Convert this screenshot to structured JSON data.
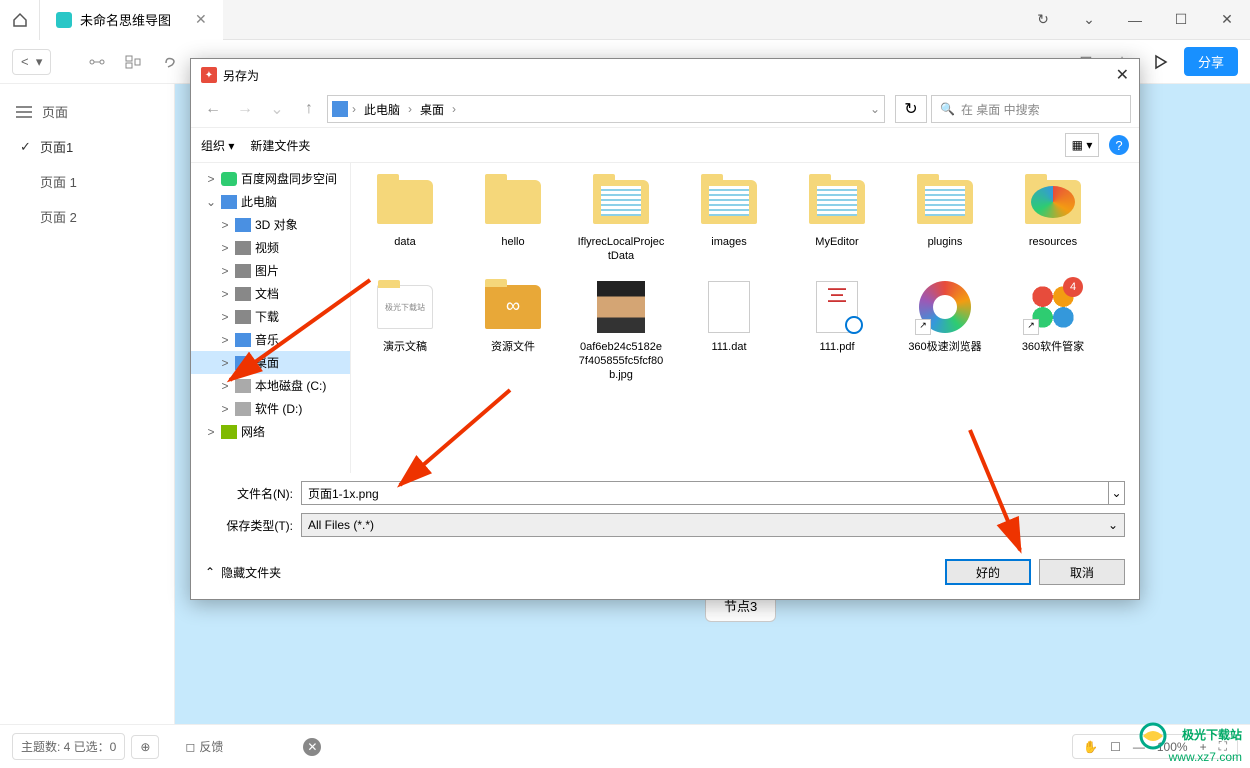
{
  "tab": {
    "title": "未命名思维导图"
  },
  "toolbar": {
    "share": "分享"
  },
  "sidebar": {
    "header": "页面",
    "items": [
      {
        "label": "页面1",
        "active": true
      },
      {
        "label": "页面 1",
        "active": false
      },
      {
        "label": "页面 2",
        "active": false
      }
    ]
  },
  "canvas": {
    "node3": "节点3"
  },
  "status": {
    "topics": "主题数: 4 已选：0",
    "feedback": "反馈",
    "zoom": "100%"
  },
  "dialog": {
    "title": "另存为",
    "path": {
      "root": "此电脑",
      "current": "桌面"
    },
    "search_placeholder": "在 桌面 中搜索",
    "toolbar": {
      "organize": "组织",
      "new_folder": "新建文件夹"
    },
    "tree": [
      {
        "label": "百度网盘同步空间",
        "indent": 1,
        "exp": ">",
        "icon": "ico-cloud"
      },
      {
        "label": "此电脑",
        "indent": 1,
        "exp": "⌄",
        "icon": "ico-monitor"
      },
      {
        "label": "3D 对象",
        "indent": 2,
        "exp": ">",
        "icon": "ico-blue"
      },
      {
        "label": "视频",
        "indent": 2,
        "exp": ">",
        "icon": "ico-generic"
      },
      {
        "label": "图片",
        "indent": 2,
        "exp": ">",
        "icon": "ico-generic"
      },
      {
        "label": "文档",
        "indent": 2,
        "exp": ">",
        "icon": "ico-generic"
      },
      {
        "label": "下载",
        "indent": 2,
        "exp": ">",
        "icon": "ico-generic"
      },
      {
        "label": "音乐",
        "indent": 2,
        "exp": ">",
        "icon": "ico-blue"
      },
      {
        "label": "桌面",
        "indent": 2,
        "exp": ">",
        "icon": "ico-monitor",
        "sel": true
      },
      {
        "label": "本地磁盘 (C:)",
        "indent": 2,
        "exp": ">",
        "icon": "ico-drive"
      },
      {
        "label": "软件 (D:)",
        "indent": 2,
        "exp": ">",
        "icon": "ico-drive"
      },
      {
        "label": "网络",
        "indent": 1,
        "exp": ">",
        "icon": "ico-network"
      }
    ],
    "files_row1": [
      {
        "label": "data",
        "type": "folder-empty"
      },
      {
        "label": "hello",
        "type": "folder-empty"
      },
      {
        "label": "IflyrecLocalProjectData",
        "type": "folder-full"
      },
      {
        "label": "images",
        "type": "folder-full"
      },
      {
        "label": "MyEditor",
        "type": "folder-full"
      },
      {
        "label": "plugins",
        "type": "folder-full"
      },
      {
        "label": "resources",
        "type": "app-colorful"
      }
    ],
    "files_row2": [
      {
        "label": "演示文稿",
        "type": "folder-text"
      },
      {
        "label": "资源文件",
        "type": "folder-baidu"
      },
      {
        "label": "0af6eb24c5182e7f405855fc5fcf80b.jpg",
        "type": "photo"
      },
      {
        "label": "111.dat",
        "type": "file"
      },
      {
        "label": "111.pdf",
        "type": "pdf"
      },
      {
        "label": "360极速浏览器",
        "type": "app-360"
      },
      {
        "label": "360软件管家",
        "type": "app-360s",
        "badge": "4"
      }
    ],
    "filename_label": "文件名(N):",
    "filename_value": "页面1-1x.png",
    "filetype_label": "保存类型(T):",
    "filetype_value": "All Files (*.*)",
    "hide_folders": "隐藏文件夹",
    "ok": "好的",
    "cancel": "取消"
  },
  "watermark": {
    "name": "极光下载站",
    "url": "www.xz7.com"
  }
}
